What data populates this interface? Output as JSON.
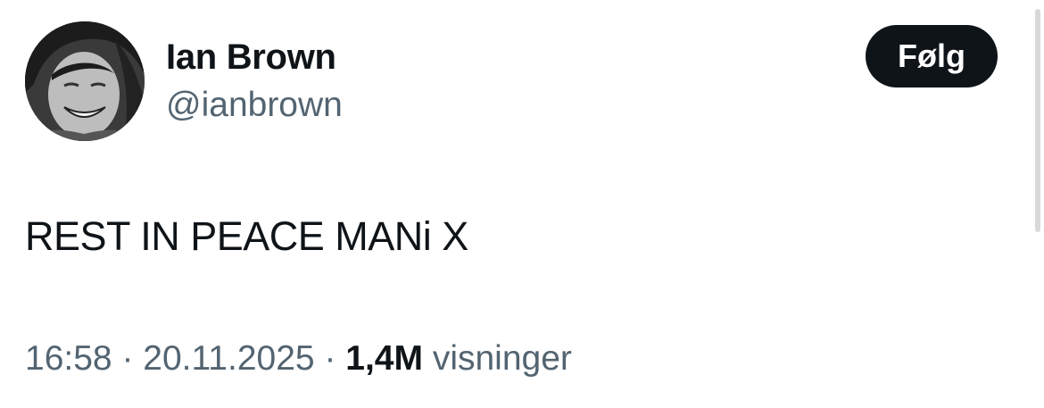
{
  "author": {
    "display_name": "Ian Brown",
    "handle": "@ianbrown"
  },
  "follow_button": {
    "label": "Følg"
  },
  "tweet": {
    "text": "REST IN PEACE MANi X"
  },
  "meta": {
    "time": "16:58",
    "separator": "·",
    "date": "20.11.2025",
    "views_count": "1,4M",
    "views_label": "visninger"
  },
  "colors": {
    "text_primary": "#0f1419",
    "text_secondary": "#536471",
    "button_bg": "#0f1419",
    "button_text": "#ffffff"
  }
}
